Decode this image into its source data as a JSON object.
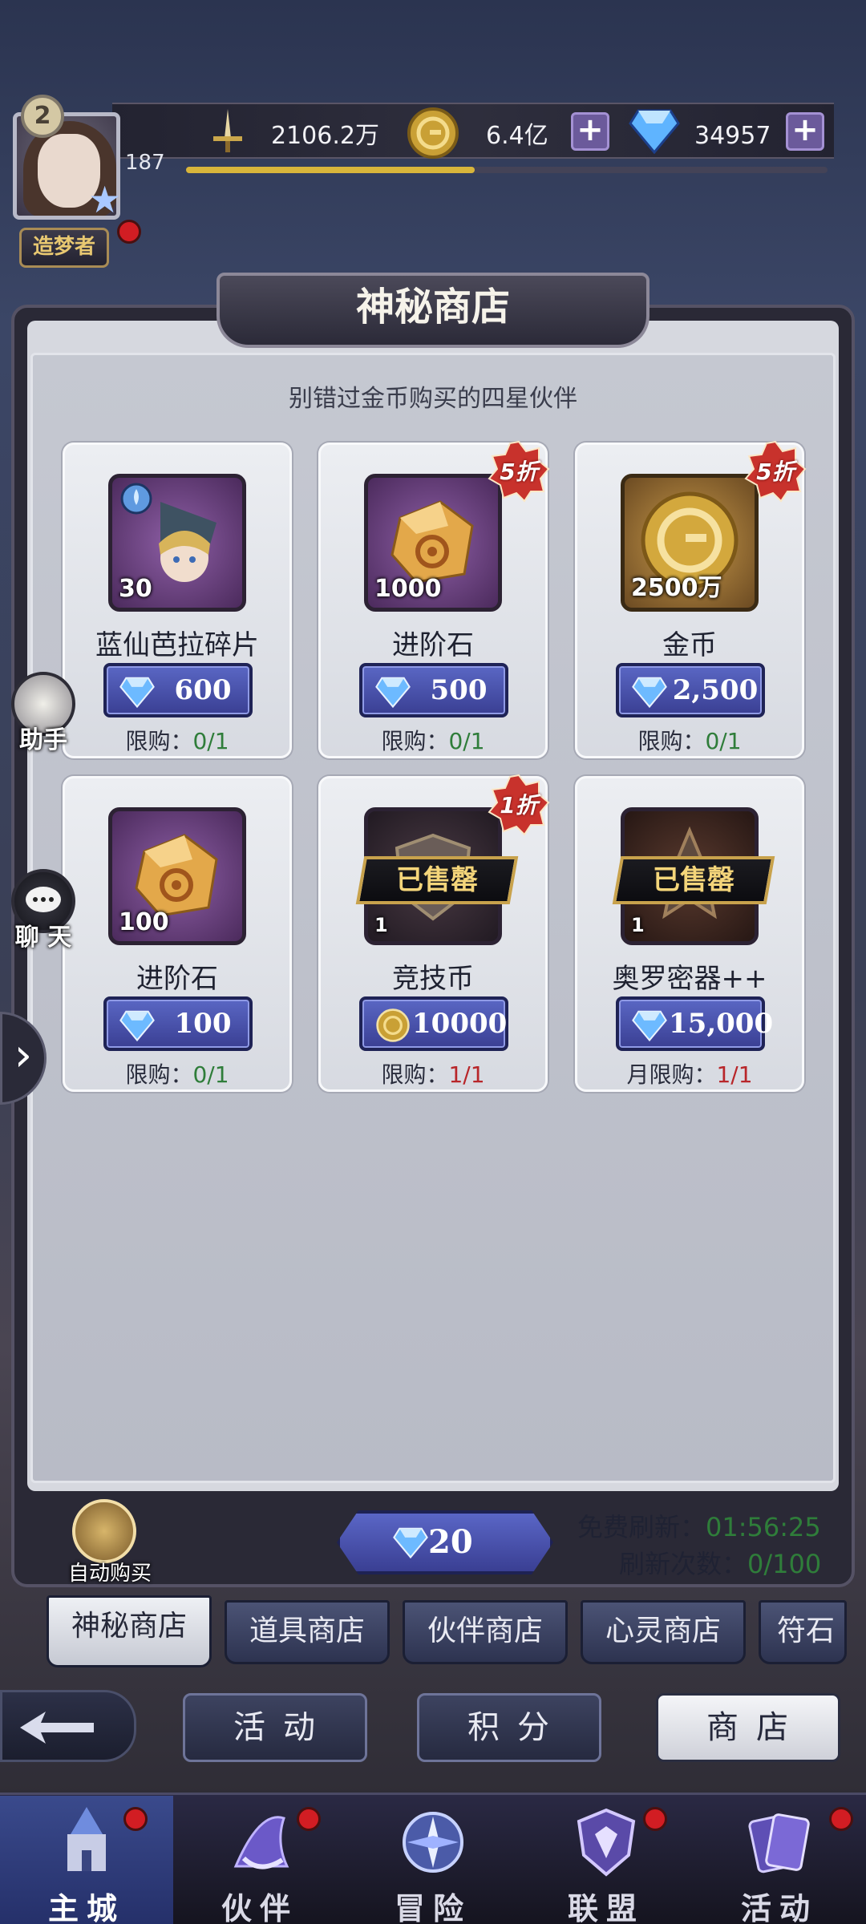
{
  "player": {
    "level": "2",
    "exp_number": "187",
    "rank_title": "造梦者"
  },
  "resources": {
    "power": "2106.2万",
    "gold": "6.4亿",
    "diamonds": "34957",
    "exp_progress": 0.45
  },
  "shop": {
    "title": "神秘商店",
    "subtitle": "别错过金币购买的四星伙伴",
    "items": [
      {
        "name": "蓝仙芭拉碎片",
        "qty": "30",
        "price": "600",
        "currency": "diamond",
        "limit_label": "限购：",
        "limit": "0/1",
        "discount": "",
        "sold_out": false
      },
      {
        "name": "进阶石",
        "qty": "1000",
        "price": "500",
        "currency": "diamond",
        "limit_label": "限购：",
        "limit": "0/1",
        "discount": "5折",
        "sold_out": false
      },
      {
        "name": "金币",
        "qty": "2500万",
        "price": "2,500",
        "currency": "diamond",
        "limit_label": "限购：",
        "limit": "0/1",
        "discount": "5折",
        "sold_out": false
      },
      {
        "name": "进阶石",
        "qty": "100",
        "price": "100",
        "currency": "diamond",
        "limit_label": "限购：",
        "limit": "0/1",
        "discount": "",
        "sold_out": false
      },
      {
        "name": "竞技币",
        "qty": "1",
        "price": "10000",
        "currency": "gold",
        "limit_label": "限购：",
        "limit": "1/1",
        "discount": "1折",
        "sold_out": true,
        "sold_out_label": "已售罄"
      },
      {
        "name": "奥罗密器++",
        "qty": "1",
        "price": "15,000",
        "currency": "diamond",
        "limit_label": "月限购：",
        "limit": "1/1",
        "discount": "",
        "sold_out": true,
        "sold_out_label": "已售罄"
      }
    ],
    "auto_buy_label": "自动购买",
    "refresh_cost": "20",
    "free_refresh_label": "免费刷新：",
    "free_refresh_time": "01:56:25",
    "refresh_count_label": "刷新次数：",
    "refresh_count": "0/100"
  },
  "shop_tabs": [
    "神秘商店",
    "道具商店",
    "伙伴商店",
    "心灵商店",
    "符石"
  ],
  "sub_nav": [
    "活动",
    "积分",
    "商店"
  ],
  "side_buttons": {
    "assistant": "助手",
    "chat": "聊 天"
  },
  "bottom_nav": [
    "主城",
    "伙伴",
    "冒险",
    "联盟",
    "活动"
  ],
  "colors": {
    "accent_blue": "#3a3f93",
    "limit_ok": "#2f7d3a",
    "limit_full": "#b8262a",
    "discount_red": "#c8322c"
  }
}
